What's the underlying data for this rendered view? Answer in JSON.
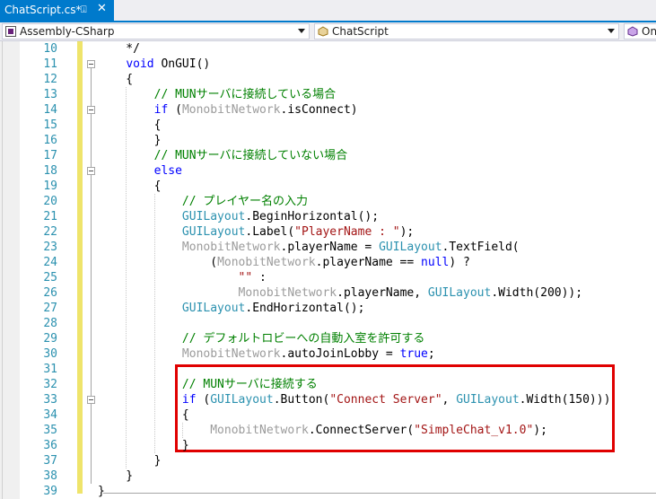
{
  "tab": {
    "title": "ChatScript.cs*",
    "pin_icon": "pin-icon",
    "close_icon": "close-icon"
  },
  "nav": {
    "project": "Assembly-CSharp",
    "class_name": "ChatScript",
    "member": "On"
  },
  "editor": {
    "line_numbers": [
      "10",
      "11",
      "12",
      "13",
      "14",
      "15",
      "16",
      "17",
      "18",
      "19",
      "20",
      "21",
      "22",
      "23",
      "24",
      "25",
      "26",
      "27",
      "28",
      "29",
      "30",
      "31",
      "32",
      "33",
      "34",
      "35",
      "36",
      "37",
      "38",
      "39"
    ],
    "lines": [
      "    */",
      "    void OnGUI()",
      "    {",
      "        // MUNサーバに接続している場合",
      "        if (MonobitNetwork.isConnect)",
      "        {",
      "        }",
      "        // MUNサーバに接続していない場合",
      "        else",
      "        {",
      "            // プレイヤー名の入力",
      "            GUILayout.BeginHorizontal();",
      "            GUILayout.Label(\"PlayerName : \");",
      "            MonobitNetwork.playerName = GUILayout.TextField(",
      "                (MonobitNetwork.playerName == null) ?",
      "                    \"\" :",
      "                    MonobitNetwork.playerName, GUILayout.Width(200));",
      "            GUILayout.EndHorizontal();",
      "",
      "            // デフォルトロビーへの自動入室を許可する",
      "            MonobitNetwork.autoJoinLobby = true;",
      "",
      "            // MUNサーバに接続する",
      "            if (GUILayout.Button(\"Connect Server\", GUILayout.Width(150)))",
      "            {",
      "                MonobitNetwork.ConnectServer(\"SimpleChat_v1.0\");",
      "            }",
      "        }",
      "    }",
      "}"
    ]
  }
}
